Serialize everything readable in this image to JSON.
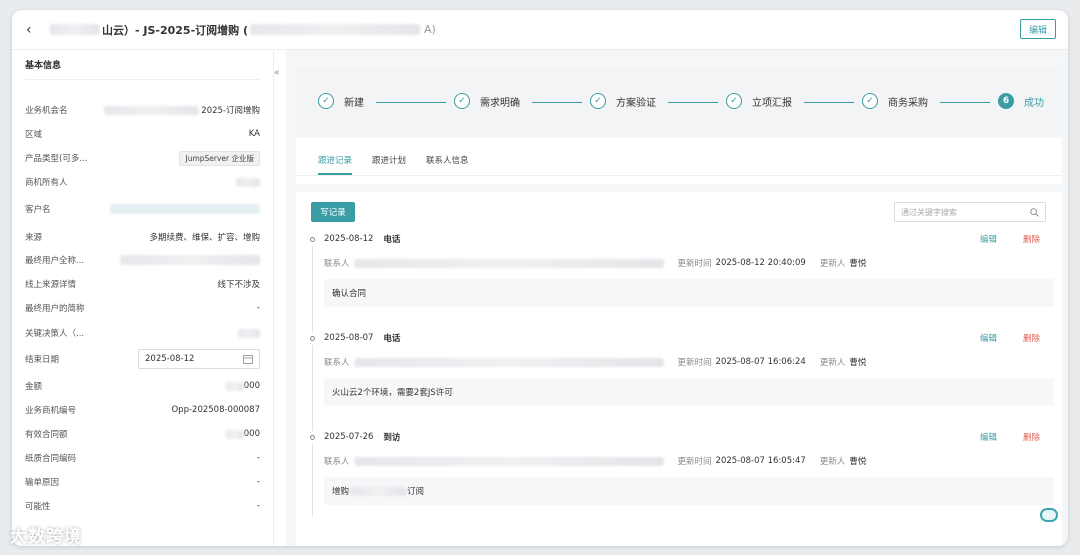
{
  "header": {
    "back_icon": "chevron-left-icon",
    "title_prefix": "山云）- JS-2025-订阅增购 (",
    "title_suffix": "A)",
    "edit_label": "编辑"
  },
  "sidebar": {
    "heading": "基本信息",
    "collapse_icon": "double-chevron-left-icon",
    "fields": [
      {
        "label": "业务机会名",
        "value": "2025-订阅增购"
      },
      {
        "label": "区域",
        "value": "KA"
      },
      {
        "label": "产品类型(可多...",
        "value": "JumpServer 企业版"
      },
      {
        "label": "商机所有人",
        "value": ""
      },
      {
        "label": "客户名",
        "value": ""
      },
      {
        "label": "来源",
        "value": "多期续费、维保、扩容、增购"
      },
      {
        "label": "最终用户全称...",
        "value": ""
      },
      {
        "label": "线上来源详情",
        "value": "线下不涉及"
      },
      {
        "label": "最终用户的简称",
        "value": "-"
      },
      {
        "label": "关键决策人（...",
        "value": ""
      },
      {
        "label": "结束日期",
        "value": "2025-08-12"
      },
      {
        "label": "金额",
        "value": "000"
      },
      {
        "label": "业务商机编号",
        "value": "Opp-202508-000087"
      },
      {
        "label": "有效合同额",
        "value": "000"
      },
      {
        "label": "纸质合同编码",
        "value": "-"
      },
      {
        "label": "输单原因",
        "value": "-"
      },
      {
        "label": "可能性",
        "value": "-"
      }
    ]
  },
  "steps": [
    {
      "label": "新建",
      "icon": "check-icon"
    },
    {
      "label": "需求明确",
      "icon": "check-icon"
    },
    {
      "label": "方案验证",
      "icon": "check-icon"
    },
    {
      "label": "立项汇报",
      "icon": "check-icon"
    },
    {
      "label": "商务采购",
      "icon": "check-icon"
    },
    {
      "label": "成功",
      "number": "6"
    }
  ],
  "tabs": [
    "跟进记录",
    "跟进计划",
    "联系人信息"
  ],
  "toolbar": {
    "write_label": "写记录",
    "search_placeholder": "通过关键字搜索"
  },
  "records": [
    {
      "date": "2025-08-12",
      "type": "电话",
      "contact_label": "联系人",
      "updated_label": "更新时间",
      "updated_time": "2025-08-12 20:40:09",
      "updater_label": "更新人",
      "updater": "曹悦",
      "content": "确认合同",
      "edit": "编辑",
      "delete": "删除"
    },
    {
      "date": "2025-08-07",
      "type": "电话",
      "contact_label": "联系人",
      "updated_label": "更新时间",
      "updated_time": "2025-08-07 16:06:24",
      "updater_label": "更新人",
      "updater": "曹悦",
      "content": "火山云2个环境，需要2套JS许可",
      "edit": "编辑",
      "delete": "删除"
    },
    {
      "date": "2025-07-26",
      "type": "到访",
      "contact_label": "联系人",
      "updated_label": "更新时间",
      "updated_time": "2025-08-07 16:05:47",
      "updater_label": "更新人",
      "updater": "曹悦",
      "content_prefix": "增购",
      "content_suffix": "订阅",
      "edit": "编辑",
      "delete": "删除"
    }
  ],
  "watermark": "大数跨境",
  "colors": {
    "accent": "#3a9ca5",
    "danger": "#e05a4f"
  }
}
